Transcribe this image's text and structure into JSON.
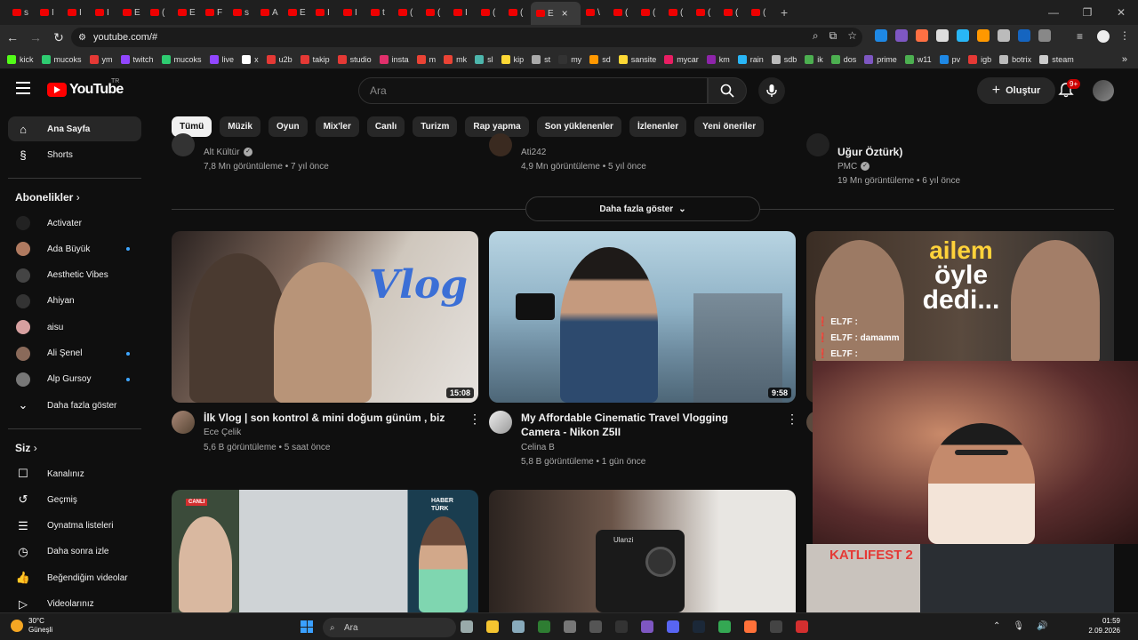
{
  "browser": {
    "tabs": [
      "s",
      "I",
      "I",
      "I",
      "E",
      "(",
      "E",
      "F",
      "s",
      "A",
      "E",
      "I",
      "I",
      "t",
      "(",
      "(",
      "I",
      "(",
      "(",
      "E",
      "\\",
      "(",
      "(",
      "(",
      "(",
      "(",
      "("
    ],
    "active_tab_close": "×",
    "new_tab": "+",
    "url": "youtube.com/#",
    "bookmarks": [
      "kick",
      "mucoks",
      "ym",
      "twitch",
      "mucoks",
      "live",
      "x",
      "u2b",
      "takip",
      "studio",
      "insta",
      "m",
      "mk",
      "sl",
      "kip",
      "st",
      "my",
      "sd",
      "sansite",
      "mycar",
      "km",
      "rain",
      "sdb",
      "ik",
      "dos",
      "prime",
      "w11",
      "pv",
      "igb",
      "botrix",
      "steam"
    ],
    "bookmark_overflow": "»"
  },
  "colors": {
    "accent": "#ff0000",
    "chip_selected": "#f1f1f1",
    "dot": "#3ea6ff"
  },
  "header": {
    "logo_text": "YouTube",
    "region": "TR",
    "search_placeholder": "Ara",
    "create_label": "Oluştur",
    "notif_badge": "9+"
  },
  "sidebar": {
    "main": [
      {
        "label": "Ana Sayfa",
        "icon": "home-icon"
      },
      {
        "label": "Shorts",
        "icon": "shorts-icon"
      }
    ],
    "subs_heading": "Abonelikler",
    "subs": [
      {
        "label": "Activater",
        "dot": false
      },
      {
        "label": "Ada Büyük",
        "dot": true
      },
      {
        "label": "Aesthetic Vibes",
        "dot": false
      },
      {
        "label": "Ahiyan",
        "dot": false
      },
      {
        "label": "aisu",
        "dot": false
      },
      {
        "label": "Ali Şenel",
        "dot": true
      },
      {
        "label": "Alp Gursoy",
        "dot": true
      }
    ],
    "show_more": "Daha fazla göster",
    "you_heading": "Siz",
    "you": [
      {
        "label": "Kanalınız",
        "icon": "channel-icon"
      },
      {
        "label": "Geçmiş",
        "icon": "history-icon"
      },
      {
        "label": "Oynatma listeleri",
        "icon": "playlist-icon"
      },
      {
        "label": "Daha sonra izle",
        "icon": "clock-icon"
      },
      {
        "label": "Beğendiğim videolar",
        "icon": "thumbs-up-icon"
      },
      {
        "label": "Videolarınız",
        "icon": "video-icon"
      }
    ]
  },
  "chips": [
    "Tümü",
    "Müzik",
    "Oyun",
    "Mix'ler",
    "Canlı",
    "Turizm",
    "Rap yapma",
    "Son yüklenenler",
    "İzlenenler",
    "Yeni öneriler"
  ],
  "top_row": [
    {
      "channel": "Alt Kültür",
      "meta": "7,8 Mn görüntüleme • 7 yıl önce"
    },
    {
      "channel": "Ati242",
      "meta": "4,9 Mn görüntüleme • 5 yıl önce"
    },
    {
      "title_tail": "Uğur Öztürk)",
      "channel": "PMC",
      "meta": "19 Mn görüntüleme • 6 yıl önce"
    }
  ],
  "more_label": "Daha fazla göster",
  "videos": [
    {
      "title": "İlk Vlog | son kontrol & mini doğum günüm , biz",
      "channel": "Ece Çelik",
      "meta": "5,6 B görüntüleme • 5 saat önce",
      "duration": "15:08",
      "thumb_text": "Vlog"
    },
    {
      "title": "My Affordable Cinematic Travel Vlogging Camera - Nikon Z5II",
      "channel": "Celina B",
      "meta": "5,8 B görüntüleme • 1 gün önce",
      "duration": "9:58"
    }
  ],
  "overlay_thumb": {
    "big_text_1": "ailem",
    "big_text_2": "öyle",
    "big_text_3": "dedi...",
    "chat": [
      "EL7F : ",
      "EL7F : damamm",
      "EL7F : "
    ]
  },
  "bottom_row": {
    "live_label": "CANLI",
    "news_label": "HABER TÜRK",
    "camera_brand": "Ulanzi",
    "katlifest": "KATLIFEST 2"
  },
  "taskbar": {
    "weather_temp": "30°C",
    "weather_desc": "Güneşli",
    "search": "Ara",
    "time": "01:59",
    "date": "2.09.2026"
  }
}
